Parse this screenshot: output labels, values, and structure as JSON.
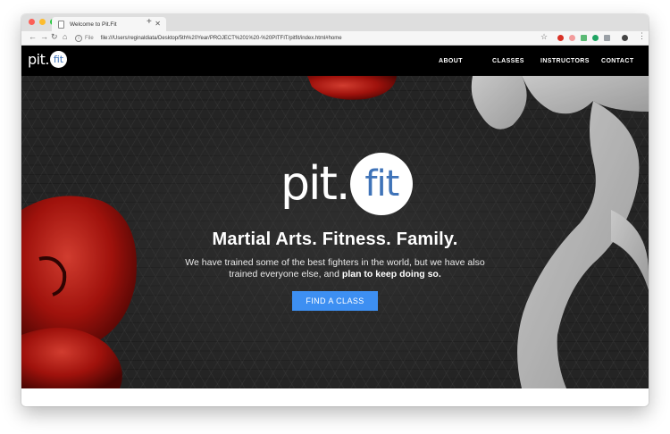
{
  "browser": {
    "tab_title": "Welcome to Pit.Fit",
    "url_scheme_label": "File",
    "url": "file:///Users/reginaldiata/Desktop/5th%20Year/PROJECT%201%20-%20PITFIT/pitfit/index.html#home",
    "colors": {
      "close": "#fc5f57",
      "minimize": "#fdbc2e",
      "maximize": "#28c840"
    }
  },
  "site": {
    "logo": {
      "pit": "pit.",
      "fit": "fit"
    },
    "nav": [
      "ABOUT",
      "CLASSES",
      "INSTRUCTORS",
      "CONTACT"
    ],
    "hero": {
      "headline": "Martial Arts. Fitness. Family.",
      "subtitle_line1": "We have trained some of the best fighters in the world, but we have also",
      "subtitle_line2_prefix": "trained everyone else, and ",
      "subtitle_line2_bold": "plan to keep doing so.",
      "cta": "FIND A CLASS"
    },
    "colors": {
      "accent": "#3d8ff2",
      "logo_blue": "#3f73b8",
      "nav_bg": "#000000"
    }
  }
}
